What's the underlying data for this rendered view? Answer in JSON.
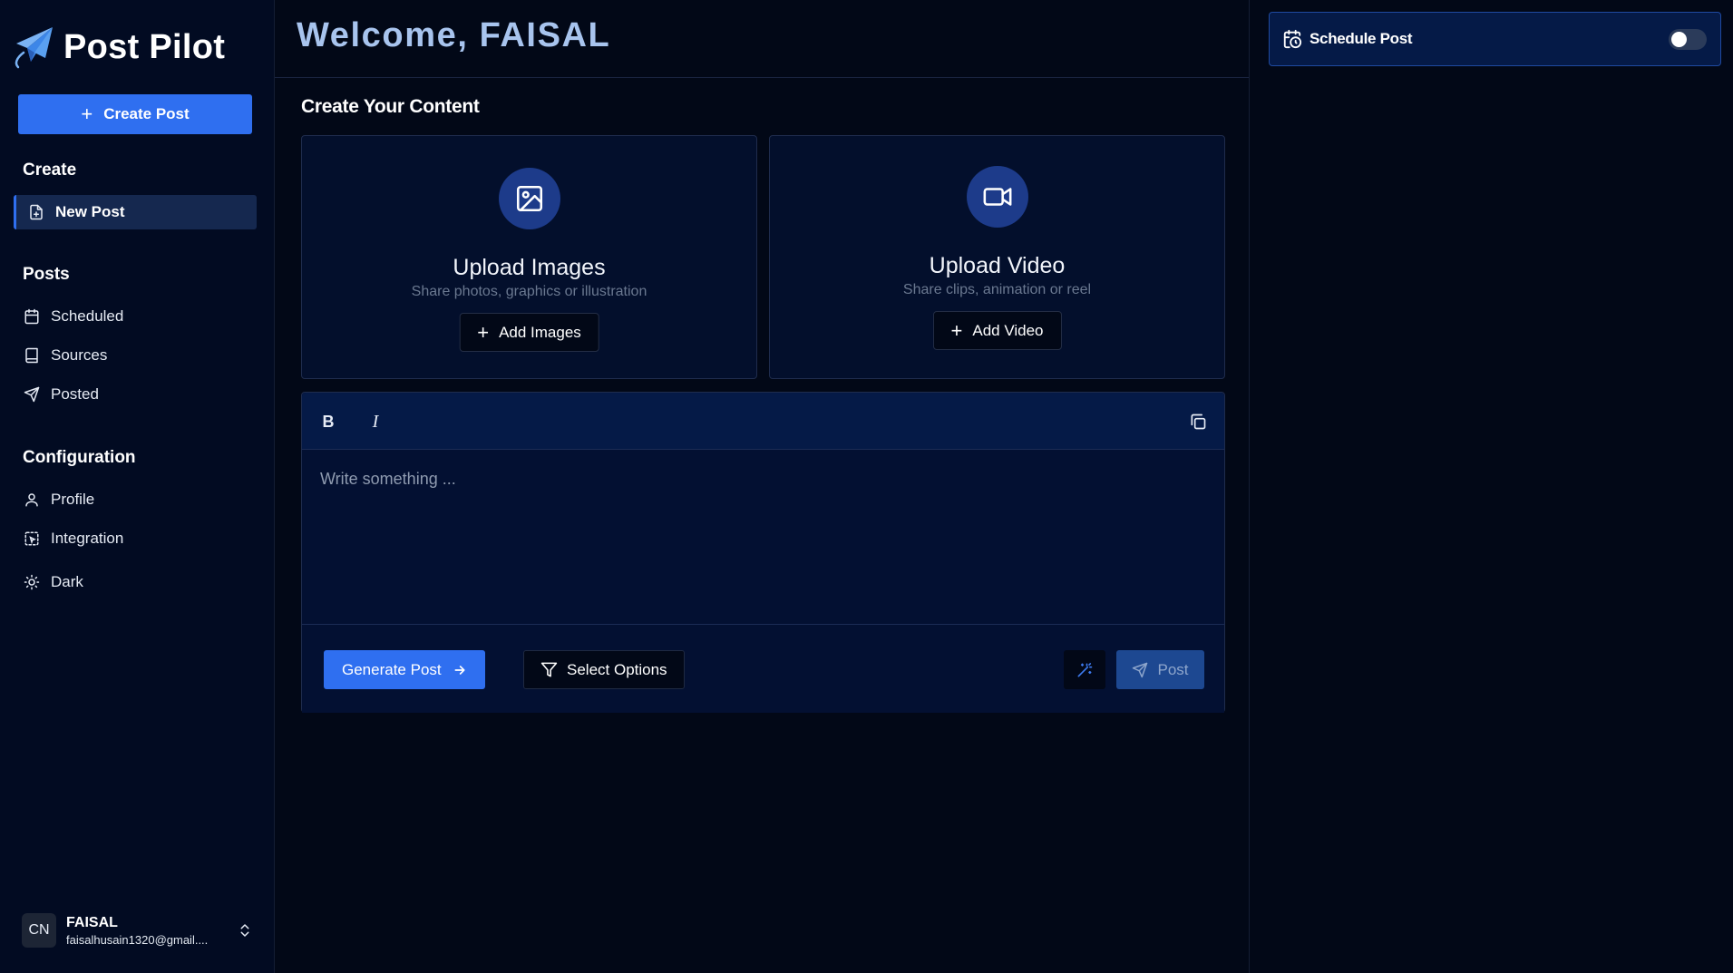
{
  "brand": {
    "name": "Post Pilot"
  },
  "sidebar": {
    "create_button": "Create Post",
    "sections": [
      {
        "title": "Create",
        "items": [
          {
            "label": "New Post",
            "icon": "file-plus-icon",
            "active": true
          }
        ]
      },
      {
        "title": "Posts",
        "items": [
          {
            "label": "Scheduled",
            "icon": "calendar-icon"
          },
          {
            "label": "Sources",
            "icon": "book-icon"
          },
          {
            "label": "Posted",
            "icon": "send-icon"
          }
        ]
      },
      {
        "title": "Configuration",
        "items": [
          {
            "label": "Profile",
            "icon": "user-icon"
          },
          {
            "label": "Integration",
            "icon": "integration-icon"
          },
          {
            "label": "Dark",
            "icon": "sun-icon"
          }
        ]
      }
    ],
    "user": {
      "initials": "CN",
      "name": "FAISAL",
      "email": "faisalhusain1320@gmail...."
    }
  },
  "main": {
    "welcome": "Welcome, FAISAL",
    "content_title": "Create Your Content",
    "upload_images": {
      "title": "Upload Images",
      "subtitle": "Share photos, graphics or illustration",
      "button": "Add Images"
    },
    "upload_video": {
      "title": "Upload Video",
      "subtitle": "Share clips, animation or reel",
      "button": "Add Video"
    },
    "editor": {
      "bold": "B",
      "italic": "I",
      "placeholder": "Write something ...",
      "generate_button": "Generate Post",
      "options_button": "Select Options",
      "post_button": "Post"
    }
  },
  "right": {
    "schedule_label": "Schedule Post",
    "schedule_enabled": false
  },
  "colors": {
    "accent": "#2f6ff0",
    "background": "#020817",
    "sidebar": "#020b22",
    "card": "#030f2c",
    "toolbar": "#051a47"
  }
}
